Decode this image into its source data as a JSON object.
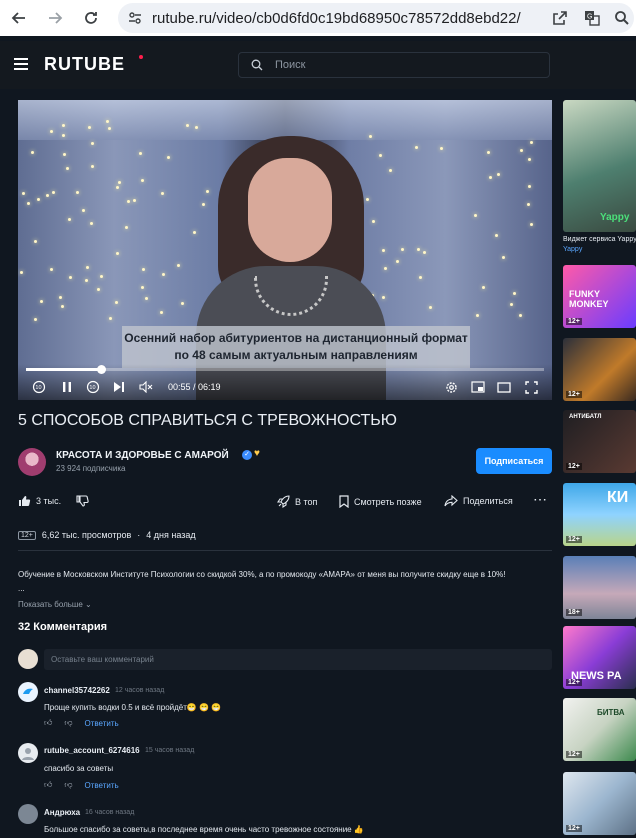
{
  "browser": {
    "url": "rutube.ru/video/cb0d6fd0c19bd68950c78572dd8ebd22/"
  },
  "header": {
    "logo": "RUTUBE",
    "search_placeholder": "Поиск"
  },
  "player": {
    "caption_line1": "Осенний набор абитуриентов на дистанционный формат",
    "caption_line2": "по 48 самым актуальным направлениям",
    "time": "00:55 / 06:19",
    "progress": 0.145,
    "skip_back": "10",
    "skip_forward": "10"
  },
  "video": {
    "title": "5 СПОСОБОВ СПРАВИТЬСЯ С ТРЕВОЖНОСТЬЮ",
    "channel_name": "КРАСОТА И ЗДОРОВЬЕ С АМАРОЙ",
    "subscribers": "23 924 подписчика",
    "subscribe_label": "Подписаться",
    "likes": "3 тыс.",
    "actions": {
      "top": "В топ",
      "watch_later": "Смотреть позже",
      "share": "Поделиться"
    },
    "age_rating": "12+",
    "views": "6,62 тыс. просмотров",
    "dot": "·",
    "published": "4 дня назад",
    "description": "Обучение в Московском Институте Психологии со скидкой 30%, а по промокоду «АМАРА» от меня вы получите скидку еще в 10%!",
    "description_more": "...",
    "show_more": "Показать больше"
  },
  "comments": {
    "count_title": "32 Комментария",
    "input_placeholder": "Оставьте ваш комментарий",
    "reply_label": "Ответить",
    "items": [
      {
        "user": "channel35742262",
        "time": "12 часов назад",
        "text": "Проще купить водки 0.5 и всё пройдёт😁 😁 😁"
      },
      {
        "user": "rutube_account_6274616",
        "time": "15 часов назад",
        "text": "спасибо за советы"
      },
      {
        "user": "Андрюха",
        "time": "16 часов назад",
        "text": "Большое спасибо за советы,в последнее время очень часто тревожное состояние 👍"
      }
    ]
  },
  "rail": {
    "first_title": "Виджет сервиса Yappy",
    "first_channel": "Yappy",
    "items": [
      {
        "badge": "",
        "word": "Yappy"
      },
      {
        "badge": "12+",
        "word": "FUNKY MONKEY"
      },
      {
        "badge": "12+",
        "word": ""
      },
      {
        "badge": "12+",
        "word": "АНТИБАТЛ"
      },
      {
        "badge": "12+",
        "word": "КИ"
      },
      {
        "badge": "18+",
        "word": ""
      },
      {
        "badge": "12+",
        "word": "NEWS PA"
      },
      {
        "badge": "12+",
        "word": "БИТВА"
      },
      {
        "badge": "12+",
        "word": ""
      }
    ]
  },
  "colors": {
    "background": "#101720",
    "accent": "#1a8cff",
    "logo_dot": "#ff1e4c"
  }
}
